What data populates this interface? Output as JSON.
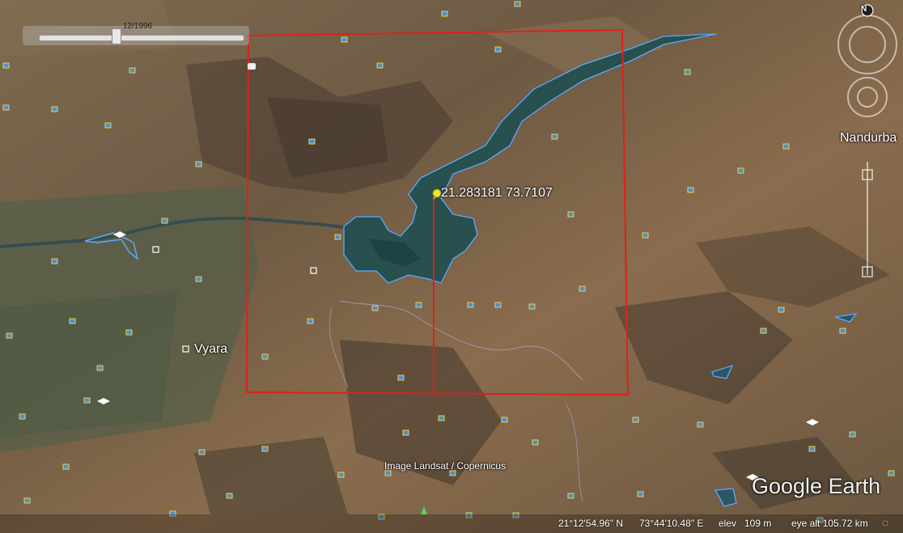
{
  "timeline": {
    "date": "12/1996"
  },
  "pin": {
    "label": "21.283181 73.7107",
    "color": "#f5e52a"
  },
  "places": [
    {
      "name": "Vyara"
    },
    {
      "name": "Nandurba"
    }
  ],
  "attribution": {
    "imagery": "Image Landsat / Copernicus",
    "brand": "Google Earth"
  },
  "status_bar": {
    "lat": "21°12'54.96\" N",
    "lon": "73°44'10.48\" E",
    "elev_label": "elev",
    "elev": "109 m",
    "eye_alt": "eye alt 105.72 km"
  },
  "compass": {
    "north": "N"
  },
  "colors": {
    "overlay_rect": "#e0201c",
    "water_outline": "#5aa9ff",
    "reservoir": "#27504f",
    "terrain": "#7a6248"
  }
}
